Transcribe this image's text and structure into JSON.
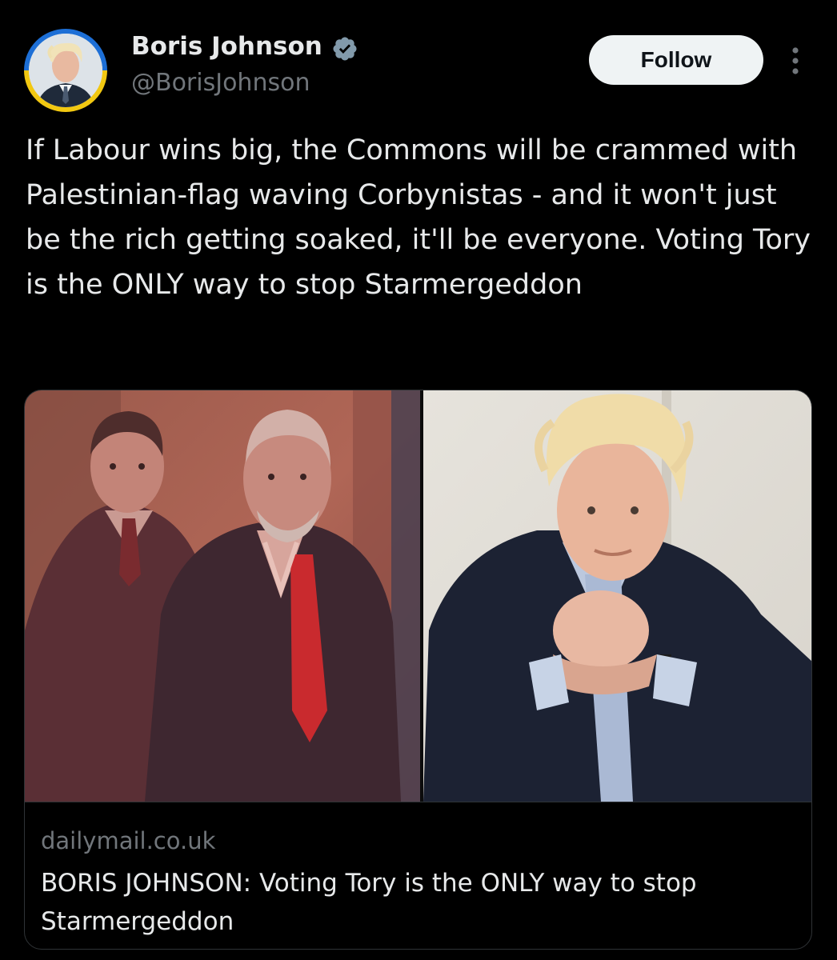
{
  "author": {
    "name": "Boris Johnson",
    "handle": "@BorisJohnson",
    "verified_icon": "verified-badge-icon",
    "avatar_ring_colors": [
      "#1d6fd6",
      "#f2c811"
    ]
  },
  "actions": {
    "follow_label": "Follow",
    "more_icon": "more-options-icon"
  },
  "tweet": {
    "text": "If Labour wins big, the Commons will be crammed with Palestinian-flag waving Corbynistas - and it won't just be the rich getting soaked, it'll be everyone. Voting Tory is the ONLY way to stop Starmergeddon"
  },
  "link_card": {
    "domain": "dailymail.co.uk",
    "title": "BORIS JOHNSON: Voting Tory is the ONLY way to stop Starmergeddon"
  },
  "colors": {
    "background": "#000000",
    "text_primary": "#e7e9ea",
    "text_secondary": "#71767b",
    "verified": "#829aab",
    "follow_bg": "#eff3f4",
    "border": "#2f3336"
  }
}
